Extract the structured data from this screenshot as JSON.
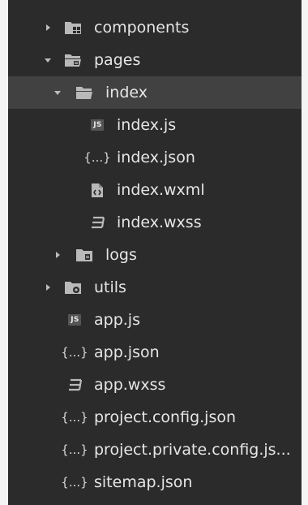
{
  "tree": {
    "rows": [
      {
        "label": "components",
        "icon": "folder-components-icon",
        "expanded": false
      },
      {
        "label": "pages",
        "icon": "folder-pages-open-icon",
        "expanded": true
      },
      {
        "label": "index",
        "icon": "folder-open-icon",
        "expanded": true,
        "selected": true
      },
      {
        "label": "index.js",
        "icon": "js-file-icon"
      },
      {
        "label": "index.json",
        "icon": "json-file-icon"
      },
      {
        "label": "index.wxml",
        "icon": "wxml-file-icon"
      },
      {
        "label": "index.wxss",
        "icon": "wxss-file-icon"
      },
      {
        "label": "logs",
        "icon": "folder-icon",
        "expanded": false
      },
      {
        "label": "utils",
        "icon": "folder-utils-icon",
        "expanded": false
      },
      {
        "label": "app.js",
        "icon": "js-file-icon"
      },
      {
        "label": "app.json",
        "icon": "json-file-icon"
      },
      {
        "label": "app.wxss",
        "icon": "wxss-file-icon"
      },
      {
        "label": "project.config.json",
        "icon": "json-file-icon"
      },
      {
        "label": "project.private.config.js...",
        "icon": "json-file-icon"
      },
      {
        "label": "sitemap.json",
        "icon": "json-file-icon"
      }
    ],
    "js_badge_text": "JS",
    "json_glyph": "{...}"
  },
  "colors": {
    "panel_bg": "#2b2b2b",
    "selected_bg": "#414141",
    "text": "#e6e6e6",
    "icon": "#b5b5b5"
  }
}
